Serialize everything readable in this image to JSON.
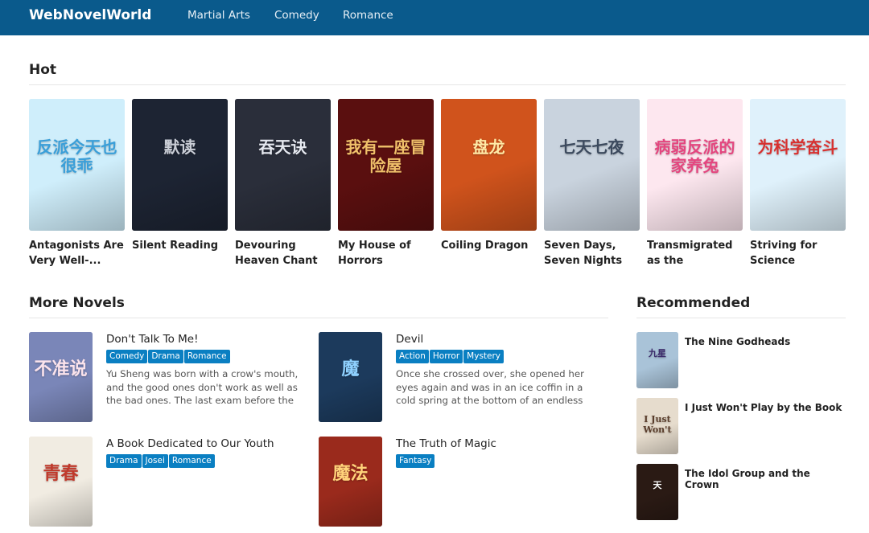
{
  "site": {
    "brand": "WebNovelWorld",
    "nav": [
      "Martial Arts",
      "Comedy",
      "Romance"
    ]
  },
  "hot": {
    "title": "Hot",
    "items": [
      {
        "title": "Antagonists Are Very Well-...",
        "art_text": "反派今天也很乖",
        "bg": "#cfeefb",
        "fg": "#3a9fd9"
      },
      {
        "title": "Silent Reading",
        "art_text": "默读",
        "bg": "#1d2433",
        "fg": "#c9cdd6"
      },
      {
        "title": "Devouring Heaven Chant",
        "art_text": "吞天诀",
        "bg": "#2a2e3a",
        "fg": "#e6e9f0"
      },
      {
        "title": "My House of Horrors",
        "art_text": "我有一座冒险屋",
        "bg": "#5a0f0f",
        "fg": "#f0c06a"
      },
      {
        "title": "Coiling Dragon",
        "art_text": "盘龙",
        "bg": "#d0531c",
        "fg": "#ffe9a6"
      },
      {
        "title": "Seven Days, Seven Nights",
        "art_text": "七天七夜",
        "bg": "#c9d3de",
        "fg": "#3c4a5e"
      },
      {
        "title": "Transmigrated as the Domesticate...",
        "art_text": "病弱反派的家养兔",
        "bg": "#fde7ef",
        "fg": "#e4467f"
      },
      {
        "title": "Striving for Science",
        "art_text": "为科学奋斗",
        "bg": "#dff1fb",
        "fg": "#d8302f"
      }
    ]
  },
  "more": {
    "title": "More Novels",
    "items": [
      {
        "title": "Don't Talk To Me!",
        "tags": [
          "Comedy",
          "Drama",
          "Romance"
        ],
        "desc": "Yu Sheng was born with a crow's mouth, and the good ones don't work as well as the bad ones. The last exam before the sophomore...",
        "art_text": "不准说",
        "bg": "#7a86b8",
        "fg": "#fbe3ec"
      },
      {
        "title": "Devil",
        "tags": [
          "Action",
          "Horror",
          "Mystery"
        ],
        "desc": "Once she crossed over, she opened her eyes again and was in an ice coffin in a cold spring at the bottom of an endless cliff.",
        "art_text": "魔",
        "bg": "#1c3a5c",
        "fg": "#8fd1ff"
      },
      {
        "title": "A Book Dedicated to Our Youth",
        "tags": [
          "Drama",
          "Josei",
          "Romance"
        ],
        "desc": "",
        "art_text": "青春",
        "bg": "#f1ece2",
        "fg": "#c0392b"
      },
      {
        "title": "The Truth of Magic",
        "tags": [
          "Fantasy"
        ],
        "desc": "",
        "art_text": "魔法",
        "bg": "#9a2a1c",
        "fg": "#ffd27a"
      }
    ]
  },
  "recommended": {
    "title": "Recommended",
    "items": [
      {
        "title": "The Nine Godheads",
        "art_text": "九星",
        "bg": "#a9c3d8",
        "fg": "#3b2a6b"
      },
      {
        "title": "I Just Won't Play by the Book",
        "art_text": "I Just Won't",
        "bg": "#e6dccd",
        "fg": "#5a3d2b"
      },
      {
        "title": "The Idol Group and the Crown",
        "art_text": "天",
        "bg": "#2a1a14",
        "fg": "#ffffff"
      }
    ]
  },
  "colors": {
    "navbar": "#0a5a8c",
    "tag": "#0a7fc2"
  }
}
